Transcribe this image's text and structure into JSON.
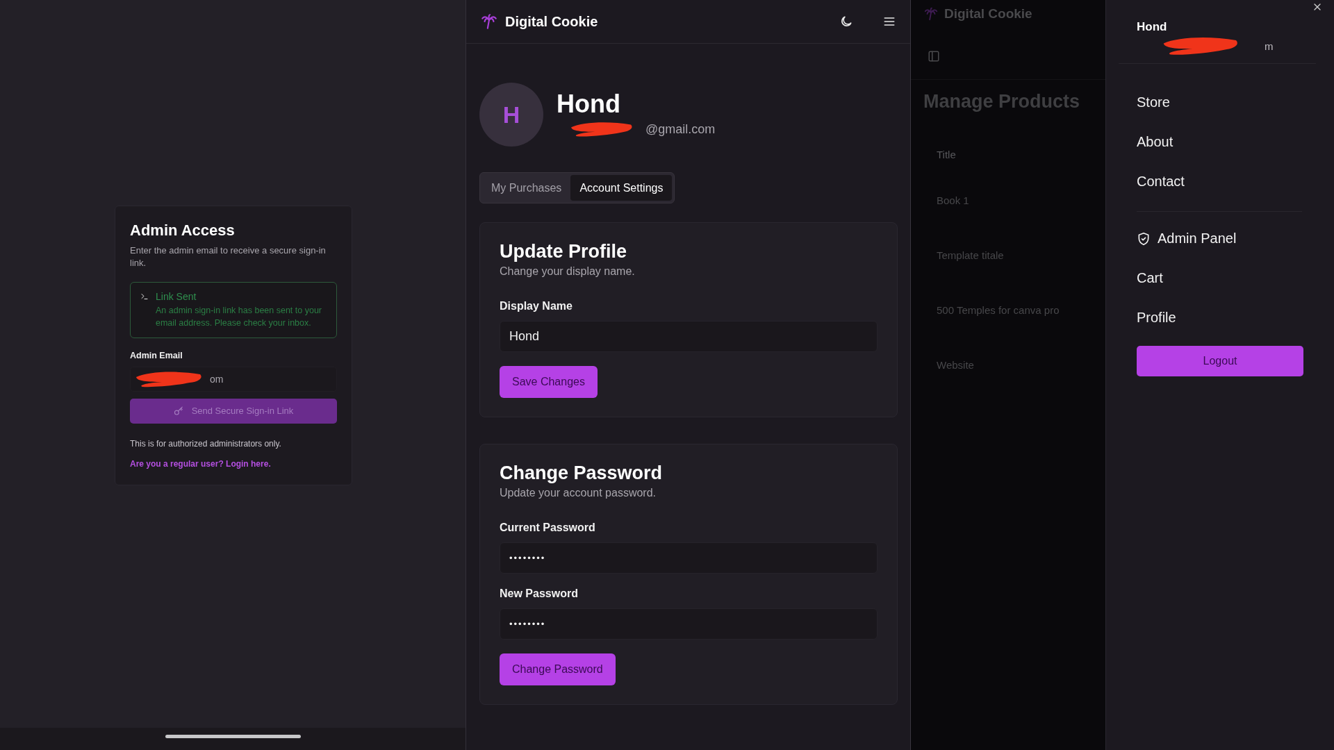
{
  "login_panel": {
    "title": "Admin Access",
    "description": "Enter the admin email to receive a secure sign-in link.",
    "alert": {
      "title": "Link Sent",
      "message": "An admin sign-in link has been sent to your email address. Please check your inbox."
    },
    "email_label": "Admin Email",
    "email_value": "om",
    "submit_button": {
      "label": "Send Secure Sign-in Link",
      "disabled": true
    },
    "note": "This is for authorized administrators only.",
    "login_link": "Are you a regular user? Login here."
  },
  "profile_panel": {
    "brand": "Digital Cookie",
    "avatar_initial": "H",
    "name": "Hond",
    "email": "@gmail.com",
    "tabs": [
      {
        "label": "My Purchases",
        "selected": false
      },
      {
        "label": "Account Settings",
        "selected": true
      }
    ],
    "cards": [
      {
        "title": "Update Profile",
        "subtitle": "Change your display name.",
        "fields": [
          {
            "label": "Display Name",
            "kind": "text",
            "value": "Hond"
          }
        ],
        "button": "Save Changes"
      },
      {
        "title": "Change Password",
        "subtitle": "Update your account password.",
        "fields": [
          {
            "label": "Current Password",
            "kind": "password",
            "value": "••••••••"
          },
          {
            "label": "New Password",
            "kind": "password",
            "value": "••••••••"
          }
        ],
        "button": "Change Password"
      }
    ]
  },
  "admin_panel": {
    "brand": "Digital Cookie",
    "dimmed": true,
    "title": "Manage Products",
    "table": {
      "columns": [
        "Title"
      ],
      "rows": [
        "Book 1",
        "Template titale",
        "500 Temples for canva pro",
        "Website"
      ]
    }
  },
  "drawer": {
    "name": "Hond",
    "email": "m",
    "primary_links": [
      {
        "label": "Store",
        "kind": "link"
      },
      {
        "label": "About",
        "kind": "link"
      },
      {
        "label": "Contact",
        "kind": "link"
      }
    ],
    "account_links": [
      {
        "label": "Admin Panel",
        "kind": "icon-link"
      },
      {
        "label": "Cart",
        "kind": "link"
      },
      {
        "label": "Profile",
        "kind": "link"
      }
    ],
    "logout_button": "Logout"
  }
}
